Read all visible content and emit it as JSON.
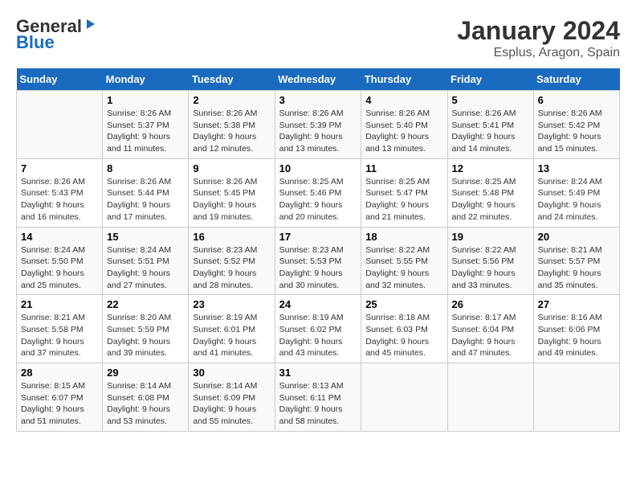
{
  "logo": {
    "general": "General",
    "blue": "Blue"
  },
  "title": "January 2024",
  "location": "Esplus, Aragon, Spain",
  "days_of_week": [
    "Sunday",
    "Monday",
    "Tuesday",
    "Wednesday",
    "Thursday",
    "Friday",
    "Saturday"
  ],
  "weeks": [
    [
      {
        "day": "",
        "info": ""
      },
      {
        "day": "1",
        "sunrise": "Sunrise: 8:26 AM",
        "sunset": "Sunset: 5:37 PM",
        "daylight": "Daylight: 9 hours and 11 minutes."
      },
      {
        "day": "2",
        "sunrise": "Sunrise: 8:26 AM",
        "sunset": "Sunset: 5:38 PM",
        "daylight": "Daylight: 9 hours and 12 minutes."
      },
      {
        "day": "3",
        "sunrise": "Sunrise: 8:26 AM",
        "sunset": "Sunset: 5:39 PM",
        "daylight": "Daylight: 9 hours and 13 minutes."
      },
      {
        "day": "4",
        "sunrise": "Sunrise: 8:26 AM",
        "sunset": "Sunset: 5:40 PM",
        "daylight": "Daylight: 9 hours and 13 minutes."
      },
      {
        "day": "5",
        "sunrise": "Sunrise: 8:26 AM",
        "sunset": "Sunset: 5:41 PM",
        "daylight": "Daylight: 9 hours and 14 minutes."
      },
      {
        "day": "6",
        "sunrise": "Sunrise: 8:26 AM",
        "sunset": "Sunset: 5:42 PM",
        "daylight": "Daylight: 9 hours and 15 minutes."
      }
    ],
    [
      {
        "day": "7",
        "sunrise": "Sunrise: 8:26 AM",
        "sunset": "Sunset: 5:43 PM",
        "daylight": "Daylight: 9 hours and 16 minutes."
      },
      {
        "day": "8",
        "sunrise": "Sunrise: 8:26 AM",
        "sunset": "Sunset: 5:44 PM",
        "daylight": "Daylight: 9 hours and 17 minutes."
      },
      {
        "day": "9",
        "sunrise": "Sunrise: 8:26 AM",
        "sunset": "Sunset: 5:45 PM",
        "daylight": "Daylight: 9 hours and 19 minutes."
      },
      {
        "day": "10",
        "sunrise": "Sunrise: 8:25 AM",
        "sunset": "Sunset: 5:46 PM",
        "daylight": "Daylight: 9 hours and 20 minutes."
      },
      {
        "day": "11",
        "sunrise": "Sunrise: 8:25 AM",
        "sunset": "Sunset: 5:47 PM",
        "daylight": "Daylight: 9 hours and 21 minutes."
      },
      {
        "day": "12",
        "sunrise": "Sunrise: 8:25 AM",
        "sunset": "Sunset: 5:48 PM",
        "daylight": "Daylight: 9 hours and 22 minutes."
      },
      {
        "day": "13",
        "sunrise": "Sunrise: 8:24 AM",
        "sunset": "Sunset: 5:49 PM",
        "daylight": "Daylight: 9 hours and 24 minutes."
      }
    ],
    [
      {
        "day": "14",
        "sunrise": "Sunrise: 8:24 AM",
        "sunset": "Sunset: 5:50 PM",
        "daylight": "Daylight: 9 hours and 25 minutes."
      },
      {
        "day": "15",
        "sunrise": "Sunrise: 8:24 AM",
        "sunset": "Sunset: 5:51 PM",
        "daylight": "Daylight: 9 hours and 27 minutes."
      },
      {
        "day": "16",
        "sunrise": "Sunrise: 8:23 AM",
        "sunset": "Sunset: 5:52 PM",
        "daylight": "Daylight: 9 hours and 28 minutes."
      },
      {
        "day": "17",
        "sunrise": "Sunrise: 8:23 AM",
        "sunset": "Sunset: 5:53 PM",
        "daylight": "Daylight: 9 hours and 30 minutes."
      },
      {
        "day": "18",
        "sunrise": "Sunrise: 8:22 AM",
        "sunset": "Sunset: 5:55 PM",
        "daylight": "Daylight: 9 hours and 32 minutes."
      },
      {
        "day": "19",
        "sunrise": "Sunrise: 8:22 AM",
        "sunset": "Sunset: 5:56 PM",
        "daylight": "Daylight: 9 hours and 33 minutes."
      },
      {
        "day": "20",
        "sunrise": "Sunrise: 8:21 AM",
        "sunset": "Sunset: 5:57 PM",
        "daylight": "Daylight: 9 hours and 35 minutes."
      }
    ],
    [
      {
        "day": "21",
        "sunrise": "Sunrise: 8:21 AM",
        "sunset": "Sunset: 5:58 PM",
        "daylight": "Daylight: 9 hours and 37 minutes."
      },
      {
        "day": "22",
        "sunrise": "Sunrise: 8:20 AM",
        "sunset": "Sunset: 5:59 PM",
        "daylight": "Daylight: 9 hours and 39 minutes."
      },
      {
        "day": "23",
        "sunrise": "Sunrise: 8:19 AM",
        "sunset": "Sunset: 6:01 PM",
        "daylight": "Daylight: 9 hours and 41 minutes."
      },
      {
        "day": "24",
        "sunrise": "Sunrise: 8:19 AM",
        "sunset": "Sunset: 6:02 PM",
        "daylight": "Daylight: 9 hours and 43 minutes."
      },
      {
        "day": "25",
        "sunrise": "Sunrise: 8:18 AM",
        "sunset": "Sunset: 6:03 PM",
        "daylight": "Daylight: 9 hours and 45 minutes."
      },
      {
        "day": "26",
        "sunrise": "Sunrise: 8:17 AM",
        "sunset": "Sunset: 6:04 PM",
        "daylight": "Daylight: 9 hours and 47 minutes."
      },
      {
        "day": "27",
        "sunrise": "Sunrise: 8:16 AM",
        "sunset": "Sunset: 6:06 PM",
        "daylight": "Daylight: 9 hours and 49 minutes."
      }
    ],
    [
      {
        "day": "28",
        "sunrise": "Sunrise: 8:15 AM",
        "sunset": "Sunset: 6:07 PM",
        "daylight": "Daylight: 9 hours and 51 minutes."
      },
      {
        "day": "29",
        "sunrise": "Sunrise: 8:14 AM",
        "sunset": "Sunset: 6:08 PM",
        "daylight": "Daylight: 9 hours and 53 minutes."
      },
      {
        "day": "30",
        "sunrise": "Sunrise: 8:14 AM",
        "sunset": "Sunset: 6:09 PM",
        "daylight": "Daylight: 9 hours and 55 minutes."
      },
      {
        "day": "31",
        "sunrise": "Sunrise: 8:13 AM",
        "sunset": "Sunset: 6:11 PM",
        "daylight": "Daylight: 9 hours and 58 minutes."
      },
      {
        "day": "",
        "info": ""
      },
      {
        "day": "",
        "info": ""
      },
      {
        "day": "",
        "info": ""
      }
    ]
  ]
}
